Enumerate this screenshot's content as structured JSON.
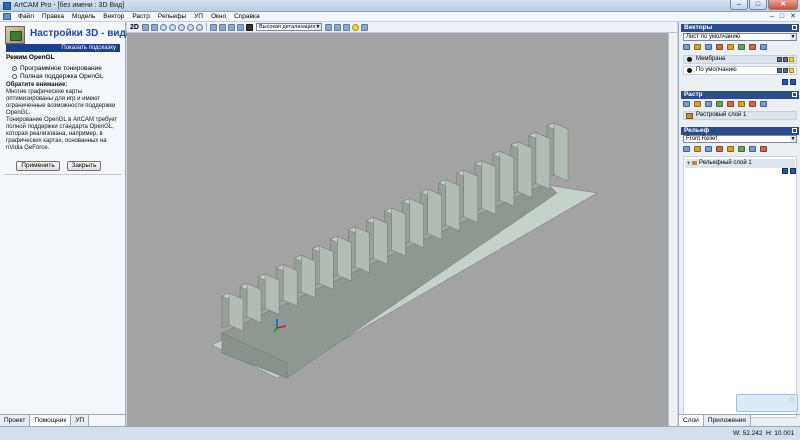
{
  "window": {
    "title": "ArtCAM Pro - [без имени : 3D Вид]",
    "minimize": "–",
    "maximize": "□",
    "close": "✕"
  },
  "menu": {
    "items": [
      "Файл",
      "Правка",
      "Модель",
      "Вектор",
      "Растр",
      "Рельефы",
      "УП",
      "Окно",
      "Справка"
    ],
    "right_controls": [
      "–",
      "□",
      "✕"
    ]
  },
  "left_panel": {
    "title": "Настройки 3D - вида",
    "show_tip": "Показать подсказку",
    "mode_label": "Режим OpenGL",
    "options": [
      {
        "label": "Программное тонирование",
        "selected": true
      },
      {
        "label": "Полная поддержка OpenGL",
        "selected": false
      }
    ],
    "note_heading": "Обратите внимание:",
    "note_p1": "Многие графические карты оптимизированы для игр и имеют ограниченные возможности поддержки OpenGL.",
    "note_p2": "Тонирование OpenGL в ArtCAM требует полной поддержки стандарта OpenGL, которая реализована, например, в графических картах, основанных на nVidia GeForce.",
    "apply_button": "Применить",
    "close_button": "Закрыть",
    "tabs": [
      "Проект",
      "Помощник",
      "УП"
    ],
    "active_tab": "Помощник"
  },
  "toolbar": {
    "view_2d": "2D",
    "detail_select": "Высокая детализация"
  },
  "right_panel": {
    "vectors": {
      "header": "Векторы",
      "sheet_select": "Лист по умолчанию",
      "layers": [
        {
          "name": "Мембрана",
          "selected": true
        },
        {
          "name": "По умолчанию",
          "selected": false
        }
      ]
    },
    "raster": {
      "header": "Растр",
      "layers": [
        {
          "name": "Растровый слой 1"
        }
      ]
    },
    "relief": {
      "header": "Рельеф",
      "select": "Front Relief",
      "layers": [
        {
          "name": "Рельефный слой 1"
        }
      ]
    },
    "tabs": [
      "Слои",
      "Приложения"
    ],
    "active_tab": "Слои"
  },
  "status_bar": {
    "w": "W: 52.242",
    "h": "H: 10.001"
  },
  "colors": {
    "viewport_bg": "#a3a3a3",
    "model_side": "#98a09b",
    "model_top": "#c3cbc6",
    "base_plate": "#c7d1cc",
    "section_header": "#2a4c8c"
  }
}
